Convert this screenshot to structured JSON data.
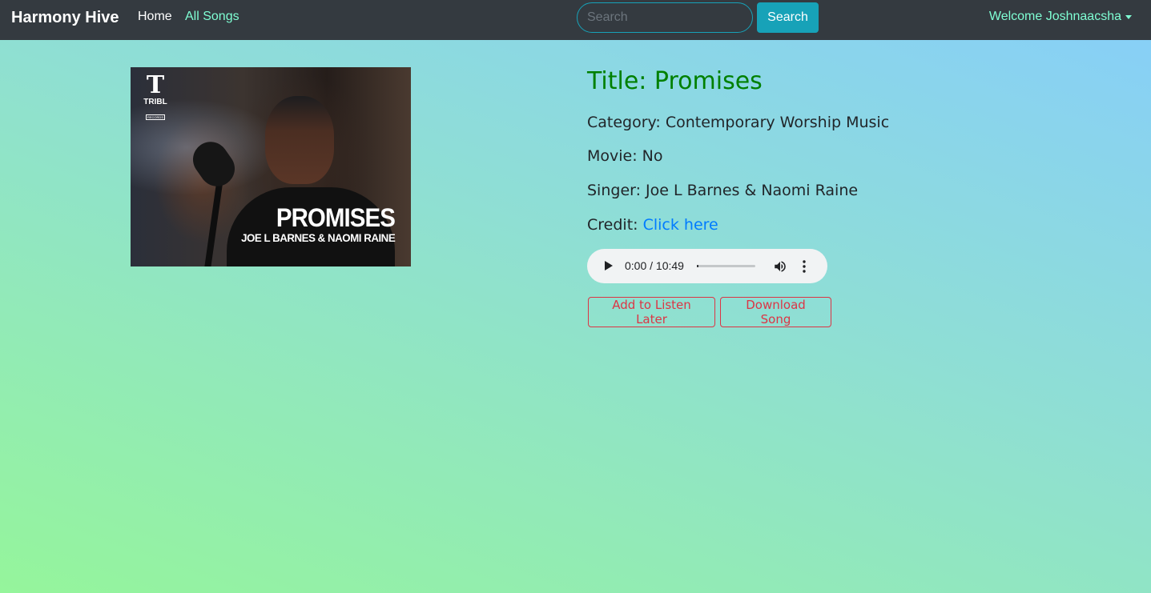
{
  "navbar": {
    "brand": "Harmony Hive",
    "links": [
      {
        "label": "Home"
      },
      {
        "label": "All Songs"
      }
    ],
    "search": {
      "placeholder": "Search",
      "value": "",
      "button_label": "Search"
    },
    "user_menu": {
      "label": "Welcome Joshnaacsha"
    }
  },
  "cover": {
    "logo_mark": "T",
    "logo_text": "TRIBL",
    "logo_sub": "RECORDS",
    "title": "PROMISES",
    "artist": "JOE L BARNES & NAOMI RAINE"
  },
  "song": {
    "title": "Title: Promises",
    "category": "Category: Contemporary Worship Music",
    "movie": "Movie: No",
    "singer": "Singer: Joe L Barnes & Naomi Raine",
    "credit_label": "Credit: ",
    "credit_link": "Click here"
  },
  "player": {
    "time": "0:00 / 10:49",
    "progress": 0.0
  },
  "actions": {
    "listen_later": "Add to Listen Later",
    "download": "Download Song"
  },
  "colors": {
    "navbar_bg": "#343a40",
    "accent": "#17a2b8",
    "title_green": "#008000",
    "danger": "#dc3545",
    "link_blue": "#007bff"
  }
}
